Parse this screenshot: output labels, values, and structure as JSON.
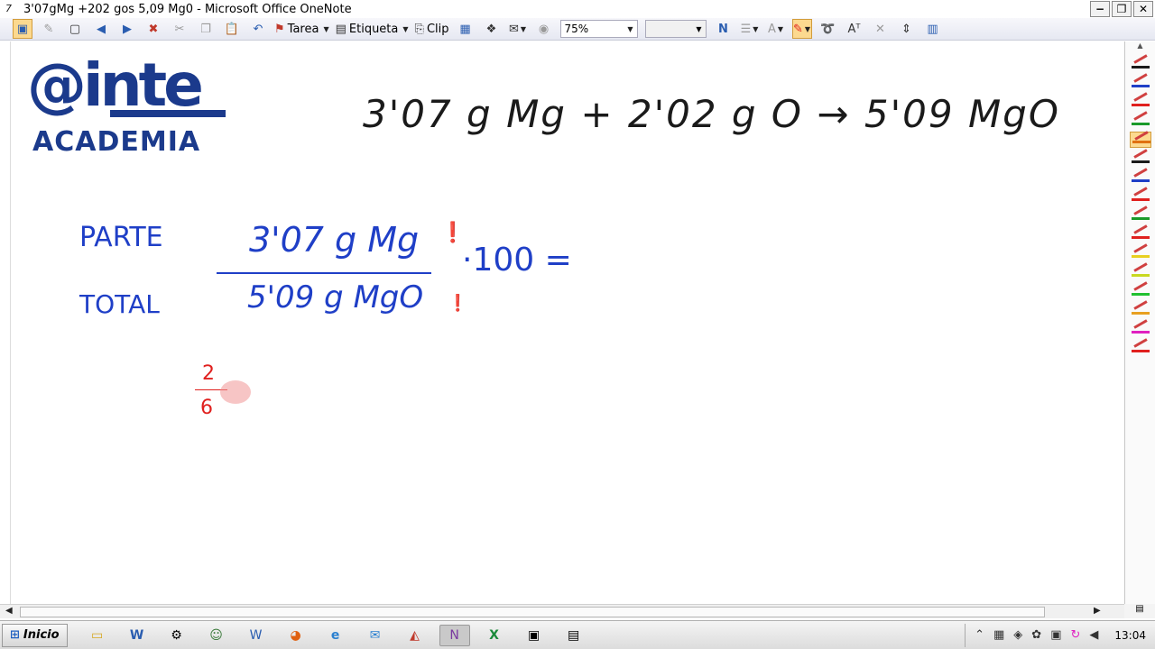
{
  "window": {
    "title": "3'07gMg +202 gos 5,09 Mg0 - Microsoft Office OneNote",
    "controls": [
      "−",
      "❐",
      "✕"
    ]
  },
  "toolbar": {
    "tarea_label": "Tarea",
    "etiqueta_label": "Etiqueta",
    "clip_label": "Clip",
    "zoom_value": "75%",
    "bold_n": "N"
  },
  "logo": {
    "at_text": "@inte",
    "academia_text": "ACADEMIA"
  },
  "ink": {
    "equation": "3'07 g Mg  + 2'02 g O → 5'09  MgO",
    "parte": "PARTE",
    "total": "TOTAL",
    "numerator": "3'07 g Mg",
    "denominator": "5'09 g MgO",
    "times_100": "·100 =",
    "small_numerator": "2",
    "small_denominator": "6"
  },
  "palette": {
    "pens": [
      {
        "color": "#1a1a1a"
      },
      {
        "color": "#1f3fc7"
      },
      {
        "color": "#e0201e"
      },
      {
        "color": "#1a9a2a"
      },
      {
        "color": "#e07010",
        "selected": true
      },
      {
        "color": "#1a1a1a"
      },
      {
        "color": "#1f3fc7"
      },
      {
        "color": "#e0201e"
      },
      {
        "color": "#1a9a2a"
      },
      {
        "color": "#e0201e"
      },
      {
        "color": "#e8d020"
      },
      {
        "color": "#c8d820"
      },
      {
        "color": "#20c030"
      },
      {
        "color": "#e8a020"
      },
      {
        "color": "#e020c0"
      },
      {
        "color": "#e0201e"
      }
    ]
  },
  "taskbar": {
    "start_label": "Inicio",
    "clock": "13:04"
  }
}
